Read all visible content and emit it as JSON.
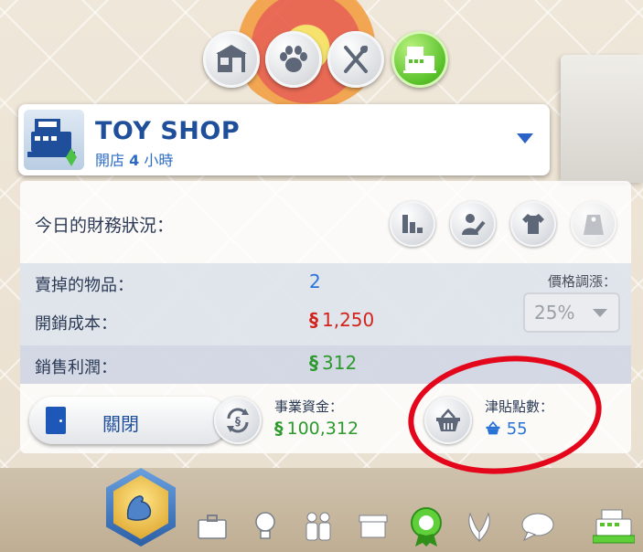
{
  "categories": [
    {
      "name": "build",
      "icon": "house-build-icon"
    },
    {
      "name": "pets",
      "icon": "paw-icon"
    },
    {
      "name": "restaurant",
      "icon": "fork-knife-icon"
    },
    {
      "name": "retail",
      "icon": "cash-register-icon",
      "active": true
    }
  ],
  "header": {
    "shop_name": "TOY SHOP",
    "open_prefix": "開店",
    "open_hours": "4",
    "open_suffix": "小時"
  },
  "finance": {
    "title": "今日的財務狀況：",
    "items_sold_label": "賣掉的物品：",
    "items_sold_value": "2",
    "cost_label": "開銷成本：",
    "cost_value": "1,250",
    "profit_label": "銷售利潤：",
    "profit_value": "312",
    "markup_label": "價格調漲：",
    "markup_value": "25%"
  },
  "actions": {
    "close_label": "關閉",
    "funds_label": "事業資金：",
    "funds_value": "100,312",
    "perk_label": "津貼點數：",
    "perk_value": "55"
  },
  "colors": {
    "accent_blue": "#1f4e9a",
    "value_blue": "#2a73d6",
    "cost_red": "#d2231c",
    "profit_green": "#2c9a2c",
    "active_green": "#59c12a",
    "annotation_red": "#e4061a"
  }
}
